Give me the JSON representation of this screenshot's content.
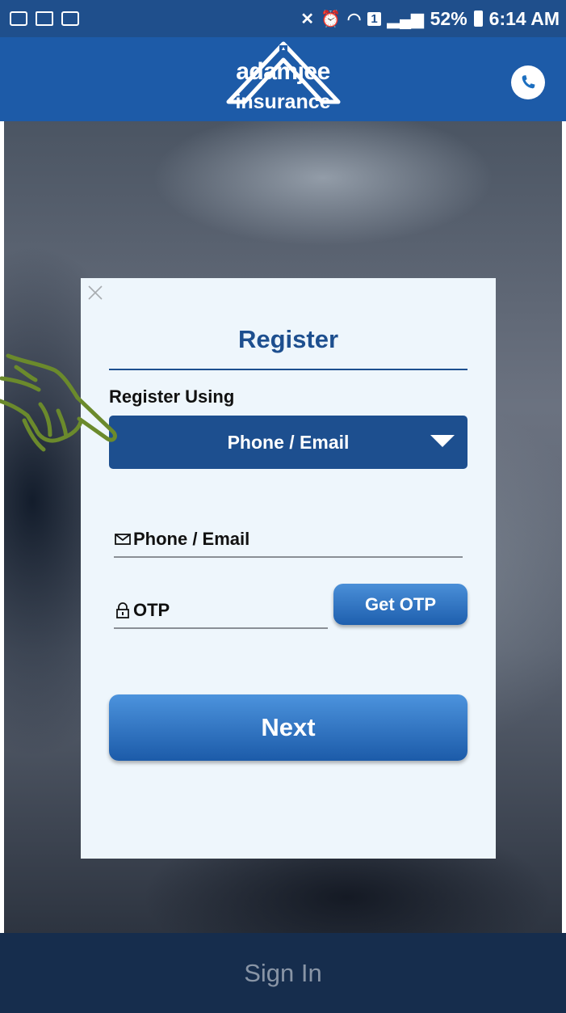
{
  "status_bar": {
    "battery": "52%",
    "time": "6:14 AM",
    "sim_slot": "1"
  },
  "header": {
    "brand": "adamjee",
    "brand_sub": "insurance",
    "call_icon": "phone-icon"
  },
  "dialog": {
    "title": "Register",
    "register_using_label": "Register Using",
    "register_using_value": "Phone / Email",
    "phone_email_placeholder": "Phone / Email",
    "otp_placeholder": "OTP",
    "get_otp_label": "Get OTP",
    "next_label": "Next"
  },
  "footer": {
    "sign_in_label": "Sign In"
  },
  "colors": {
    "primary": "#1d4f8f",
    "header": "#1d5ba8",
    "dialog_bg": "#eef6fc",
    "footer_bg": "#162d4d",
    "hand": "#6b8a2c"
  }
}
